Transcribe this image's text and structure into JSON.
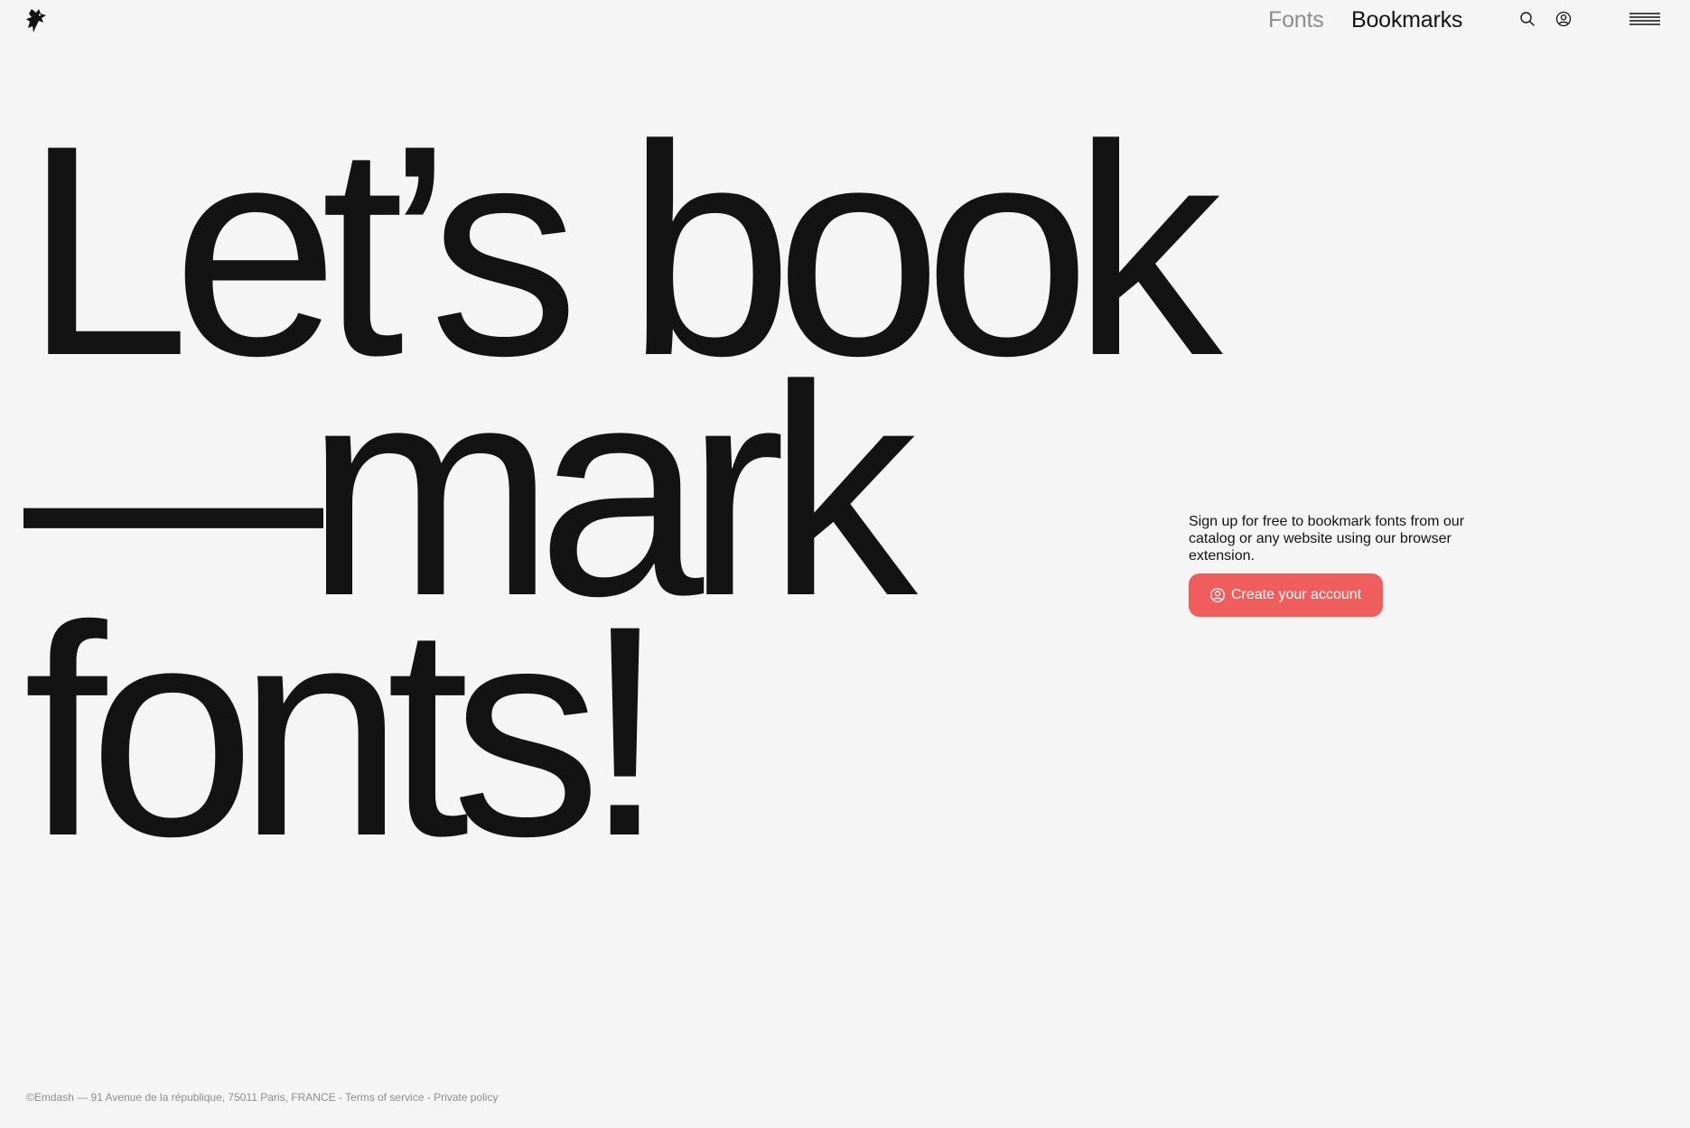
{
  "header": {
    "logo": "emdash-bird-logo",
    "nav": {
      "fonts_label": "Fonts",
      "bookmarks_label": "Bookmarks"
    },
    "icons": {
      "search": "search-icon",
      "account": "user-circle-icon",
      "menu": "hamburger-menu-icon"
    }
  },
  "hero": {
    "line1": "Let’s book",
    "line2": "—mark",
    "line3": "fonts!"
  },
  "signup": {
    "text": "Sign up for free to bookmark fonts from our catalog or any website using our browser extension.",
    "button_label": "Create your account",
    "button_icon": "user-circle-icon",
    "button_color": "#f05d5d"
  },
  "footer": {
    "address": "©Emdash — 91 Avenue de la république, 75011 Paris, FRANCE",
    "separator": " - ",
    "terms_label": "Terms of service",
    "privacy_label": "Private policy"
  },
  "colors": {
    "background": "#f5f5f5",
    "text": "#131313",
    "muted": "#8d8d8d",
    "accent": "#f05d5d"
  }
}
